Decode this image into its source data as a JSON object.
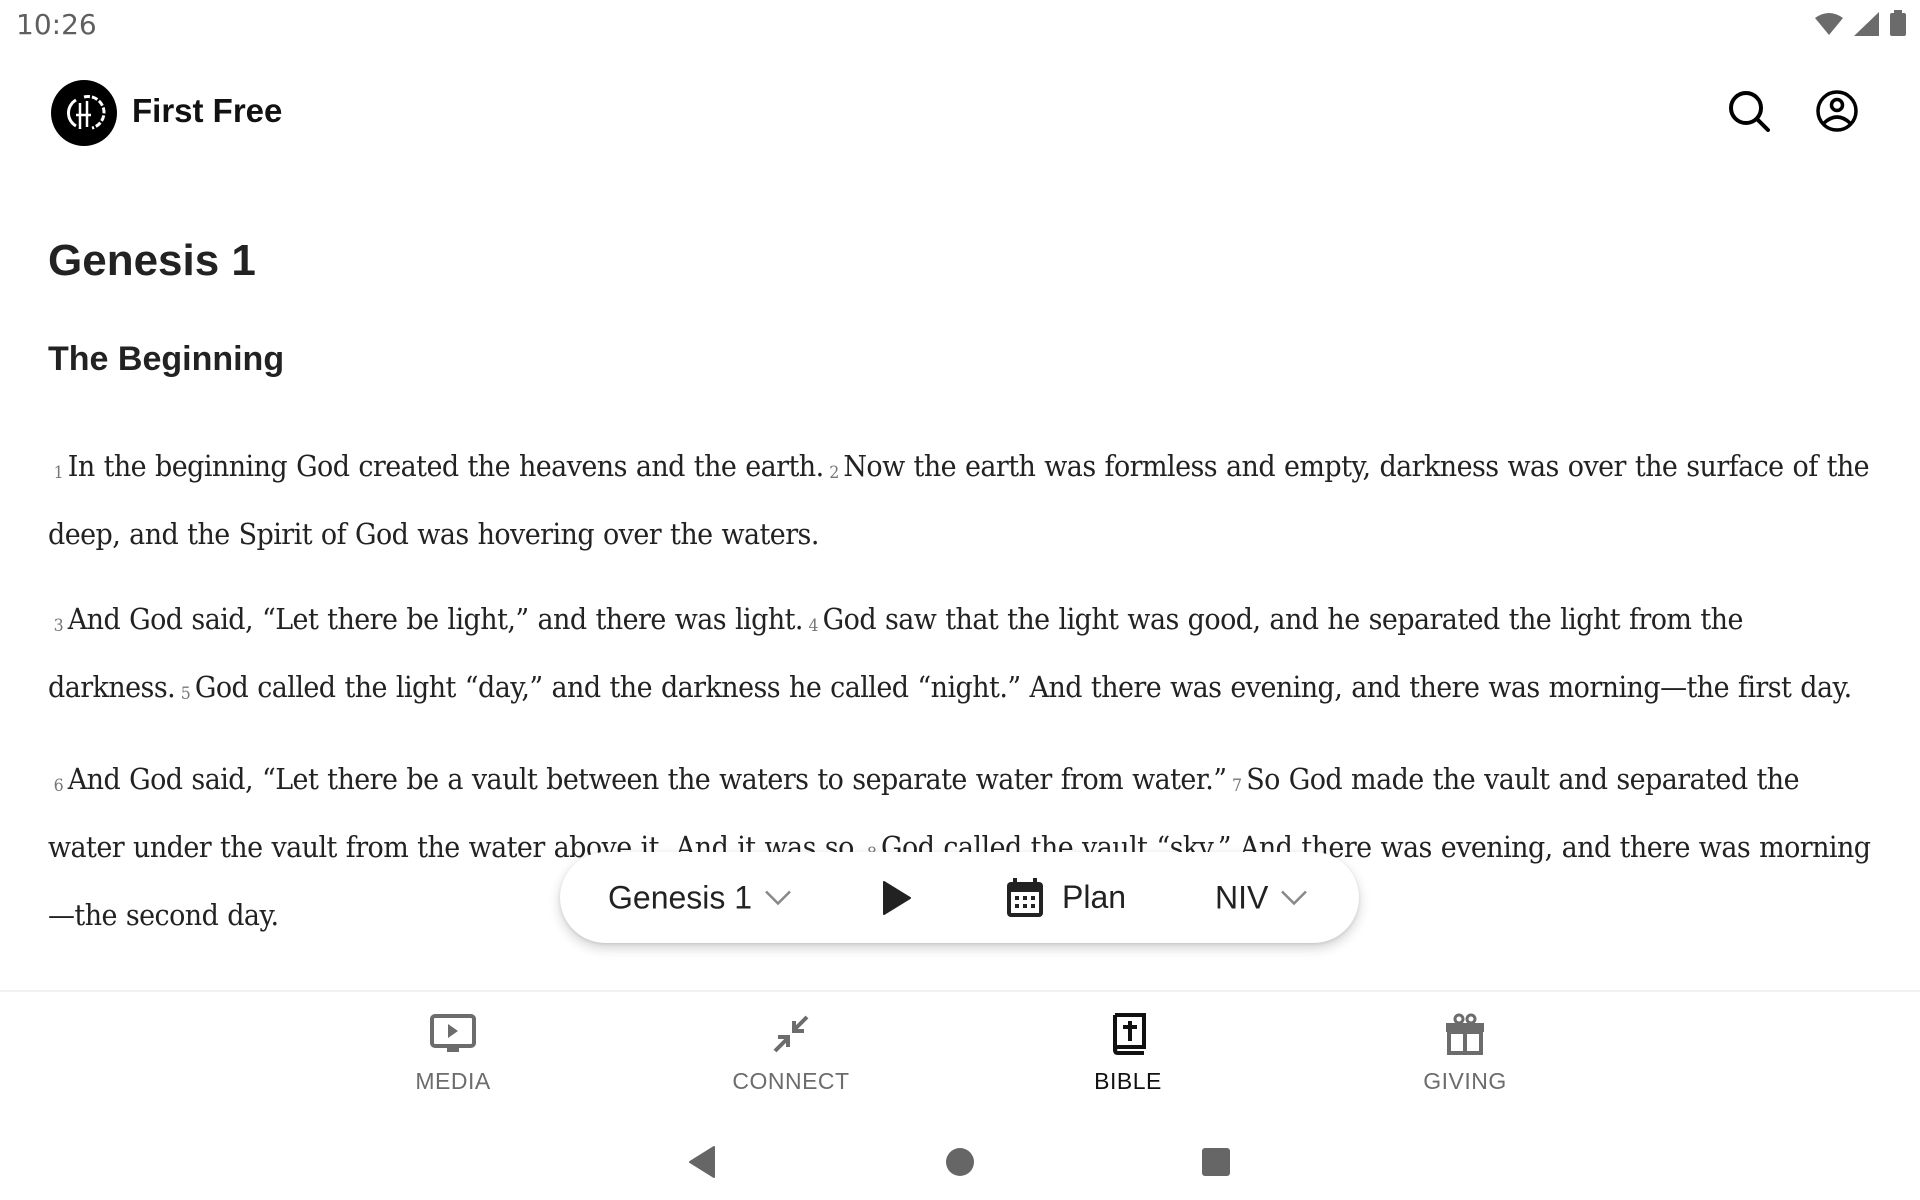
{
  "status_bar": {
    "time": "10:26",
    "icons": [
      "wifi-icon",
      "cell-signal-icon",
      "battery-icon"
    ]
  },
  "header": {
    "app_title": "First Free",
    "logo": "church-logo",
    "actions": [
      {
        "name": "search",
        "icon": "search-icon"
      },
      {
        "name": "account",
        "icon": "account-circle-icon"
      }
    ]
  },
  "reader": {
    "chapter_title": "Genesis 1",
    "section_title": "The Beginning",
    "paragraphs": [
      [
        {
          "num": "1",
          "text": "In the beginning God created the heavens and the earth."
        },
        {
          "num": "2",
          "text": "Now the earth was formless and empty, darkness was over the surface of the deep, and the Spirit of God was hovering over the waters."
        }
      ],
      [
        {
          "num": "3",
          "text": "And God said, “Let there be light,” and there was light."
        },
        {
          "num": "4",
          "text": "God saw that the light was good, and he separated the light from the darkness."
        },
        {
          "num": "5",
          "text": "God called the light “day,” and the darkness he called “night.” And there was evening, and there was morning—the first day."
        }
      ],
      [
        {
          "num": "6",
          "text": "And God said, “Let there be a vault between the waters to separate water from water.”"
        },
        {
          "num": "7",
          "text": "So God made the vault and separated the water under the vault from the water above it. And it was so."
        },
        {
          "num": "8",
          "text": "God called the vault “sky.” And there was evening, and there was morning—the second day."
        }
      ]
    ]
  },
  "floating_bar": {
    "chapter_select": "Genesis 1",
    "play_icon": "play-icon",
    "plan_label": "Plan",
    "plan_icon": "calendar-icon",
    "version_select": "NIV"
  },
  "bottom_nav": {
    "active": "BIBLE",
    "tabs": [
      {
        "label": "MEDIA",
        "icon": "tv-play-icon"
      },
      {
        "label": "CONNECT",
        "icon": "arrows-inward-icon"
      },
      {
        "label": "BIBLE",
        "icon": "bible-book-icon"
      },
      {
        "label": "GIVING",
        "icon": "gift-icon"
      }
    ]
  },
  "system_nav": {
    "buttons": [
      "back",
      "home",
      "recents"
    ]
  },
  "colors": {
    "text": "#222222",
    "verse_number": "#777777",
    "inactive_nav": "#6c6c6c",
    "active_nav": "#111111",
    "system_icon": "#666666"
  }
}
